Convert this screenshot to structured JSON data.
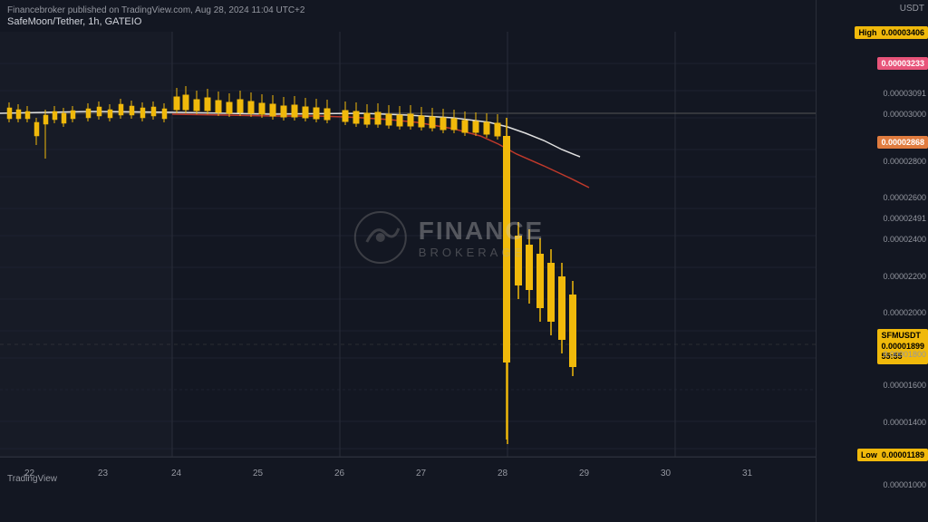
{
  "header": {
    "publisher": "Financebroker published on TradingView.com, Aug 28, 2024 11:04 UTC+2",
    "pair": "SafeMoon/Tether, 1h, GATEIO"
  },
  "price_axis": {
    "currency": "USDT",
    "labels": [
      {
        "value": "0.00003406",
        "top_pct": 7
      },
      {
        "value": "0.00003233",
        "top_pct": 13,
        "badge": "pink"
      },
      {
        "value": "0.00003091",
        "top_pct": 18
      },
      {
        "value": "0.00003000",
        "top_pct": 22
      },
      {
        "value": "0.00002868",
        "top_pct": 27,
        "badge": "orange"
      },
      {
        "value": "0.00002800",
        "top_pct": 31
      },
      {
        "value": "0.00002600",
        "top_pct": 38
      },
      {
        "value": "0.00002491",
        "top_pct": 42
      },
      {
        "value": "0.00002400",
        "top_pct": 46
      },
      {
        "value": "0.00002200",
        "top_pct": 53
      },
      {
        "value": "0.00002000",
        "top_pct": 60
      },
      {
        "value": "0.00001899",
        "top_pct": 64,
        "badge": "current"
      },
      {
        "value": "0.00001800",
        "top_pct": 67
      },
      {
        "value": "0.00001600",
        "top_pct": 74
      },
      {
        "value": "0.00001400",
        "top_pct": 81
      },
      {
        "value": "0.00001189",
        "top_pct": 87,
        "badge": "low"
      },
      {
        "value": "0.00001000",
        "top_pct": 93
      }
    ],
    "high_label": "High",
    "low_label": "Low",
    "current_label": "SFMUSDT",
    "current_time": "55:55"
  },
  "xaxis": {
    "labels": [
      {
        "text": "22",
        "left_pct": 3
      },
      {
        "text": "23",
        "left_pct": 12
      },
      {
        "text": "24",
        "left_pct": 21
      },
      {
        "text": "25",
        "left_pct": 31
      },
      {
        "text": "26",
        "left_pct": 41
      },
      {
        "text": "27",
        "left_pct": 51
      },
      {
        "text": "28",
        "left_pct": 61
      },
      {
        "text": "29",
        "left_pct": 71
      },
      {
        "text": "30",
        "left_pct": 81
      },
      {
        "text": "31",
        "left_pct": 91
      }
    ]
  },
  "watermark": {
    "title": "FINANCE",
    "subtitle": "BROKERAGE"
  },
  "tradingview_logo": "TradingView"
}
